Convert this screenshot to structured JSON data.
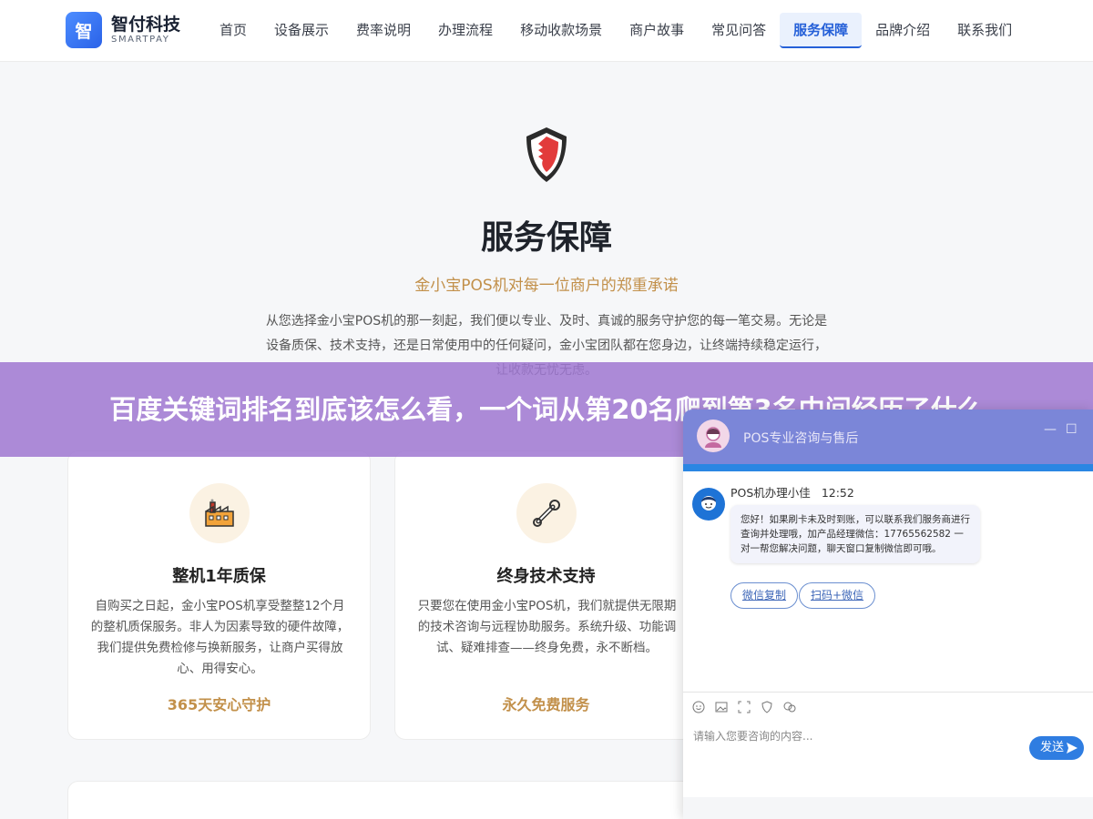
{
  "header": {
    "logo_mark": "智",
    "logo_name": "智付科技",
    "logo_sub": "SMARTPAY",
    "nav": [
      "首页",
      "设备展示",
      "费率说明",
      "办理流程",
      "移动收款场景",
      "商户故事",
      "常见问答",
      "服务保障",
      "品牌介绍",
      "联系我们"
    ],
    "active_nav": "服务保障"
  },
  "hero": {
    "title": "服务保障",
    "subtitle": "金小宝POS机对每一位商户的郑重承诺",
    "desc": "从您选择金小宝POS机的那一刻起，我们便以专业、及时、真诚的服务守护您的每一笔交易。无论是设备质保、技术支持，还是日常使用中的任何疑问，金小宝团队都在您身边，让终端持续稳定运行，让收款无忧无虑。"
  },
  "banner": {
    "text": "百度关键词排名到底该怎么看，一个词从第20名爬到第3名中间经历了什么"
  },
  "cards": [
    {
      "icon": "factory-icon",
      "title": "整机1年质保",
      "desc": "自购买之日起，金小宝POS机享受整整12个月的整机质保服务。非人为因素导致的硬件故障，我们提供免费检修与换新服务，让商户买得放心、用得安心。",
      "tag": "365天安心守护"
    },
    {
      "icon": "wrench-icon",
      "title": "终身技术支持",
      "desc": "只要您在使用金小宝POS机，我们就提供无限期的技术咨询与远程协助服务。系统升级、功能调试、疑难排查——终身免费，永不断档。",
      "tag": "永久免费服务"
    }
  ],
  "chat": {
    "title": "POS专业咨询与售后",
    "minimize": "—",
    "maximize": "☐",
    "agent_name": "POS机办理小佳",
    "time": "12:52",
    "message": "您好！如果刷卡未及时到账，可以联系我们服务商进行查询并处理哦，加产品经理微信：17765562582 一对一帮您解决问题，聊天窗口复制微信即可哦。",
    "quick_replies": [
      "微信复制",
      "扫码+微信"
    ],
    "tool_icons": [
      "emoji-icon",
      "image-icon",
      "screenshot-icon",
      "evaluate-icon",
      "chat-record-icon"
    ],
    "input_placeholder": "请输入您要咨询的内容...",
    "send_label": "发送"
  }
}
